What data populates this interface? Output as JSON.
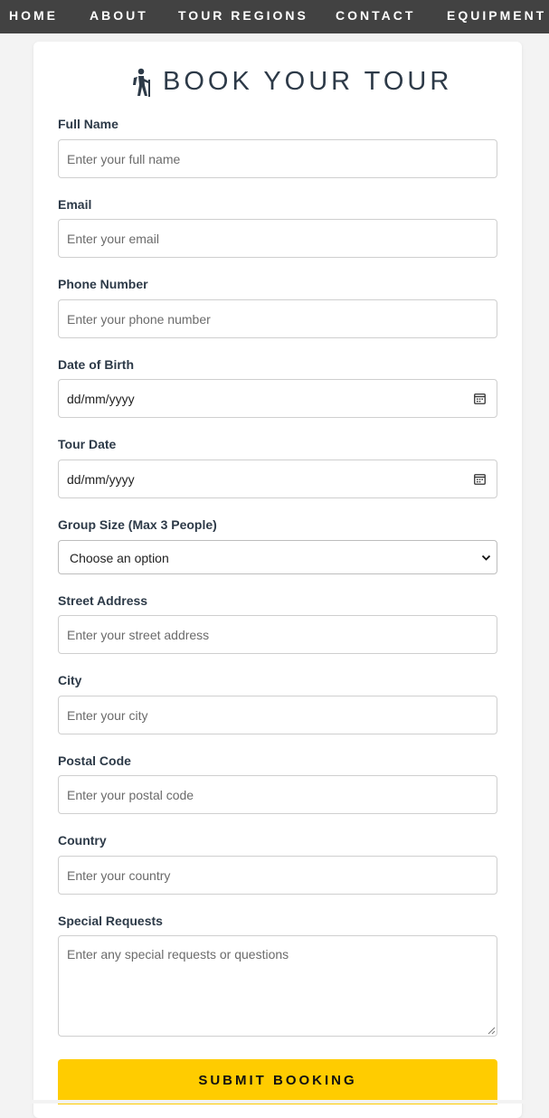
{
  "nav": {
    "items": [
      {
        "label": "HOME"
      },
      {
        "label": "ABOUT"
      },
      {
        "label": "TOUR REGIONS"
      },
      {
        "label": "CONTACT"
      },
      {
        "label": "EQUIPMENT"
      }
    ]
  },
  "form": {
    "title": "BOOK YOUR TOUR",
    "title_icon": "hiker-icon",
    "fields": {
      "full_name": {
        "label": "Full Name",
        "placeholder": "Enter your full name",
        "value": ""
      },
      "email": {
        "label": "Email",
        "placeholder": "Enter your email",
        "value": ""
      },
      "phone": {
        "label": "Phone Number",
        "placeholder": "Enter your phone number",
        "value": ""
      },
      "dob": {
        "label": "Date of Birth",
        "value": "dd/mm/yyyy",
        "icon": "calendar-icon"
      },
      "tour_date": {
        "label": "Tour Date",
        "value": "dd/mm/yyyy",
        "icon": "calendar-icon"
      },
      "group_size": {
        "label": "Group Size (Max 3 People)",
        "selected": "Choose an option",
        "icon": "chevron-down-icon"
      },
      "street": {
        "label": "Street Address",
        "placeholder": "Enter your street address",
        "value": ""
      },
      "city": {
        "label": "City",
        "placeholder": "Enter your city",
        "value": ""
      },
      "postal": {
        "label": "Postal Code",
        "placeholder": "Enter your postal code",
        "value": ""
      },
      "country": {
        "label": "Country",
        "placeholder": "Enter your country",
        "value": ""
      },
      "special": {
        "label": "Special Requests",
        "placeholder": "Enter any special requests or questions",
        "value": ""
      }
    },
    "submit_label": "SUBMIT BOOKING"
  },
  "colors": {
    "nav_bg": "#424242",
    "accent": "#ffcc00",
    "text": "#2d3a48",
    "page_bg": "#f3f3f3"
  }
}
